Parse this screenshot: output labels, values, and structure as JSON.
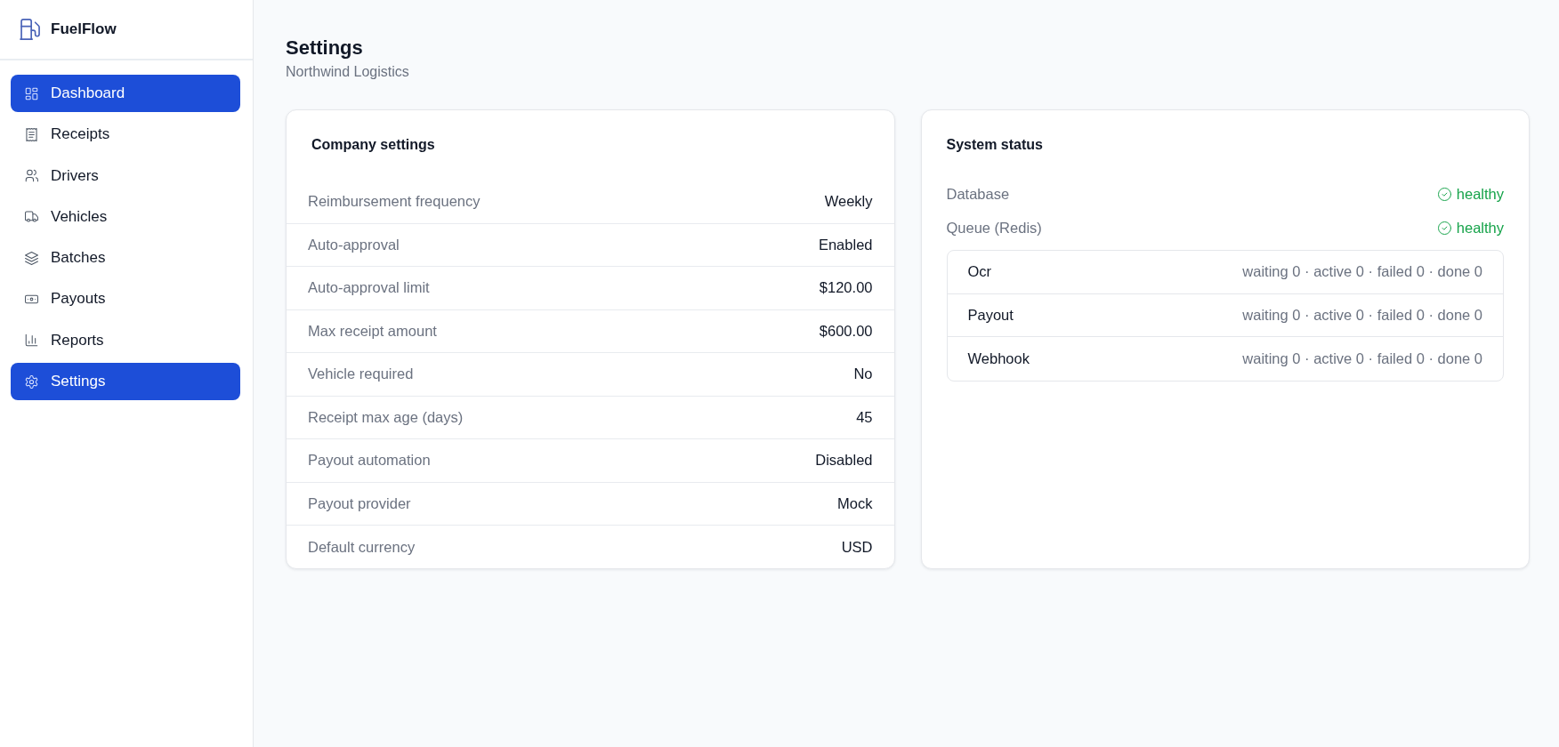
{
  "sidebar": {
    "brand": "FuelFlow",
    "items": [
      {
        "label": "Dashboard",
        "selected": true
      },
      {
        "label": "Receipts",
        "selected": false
      },
      {
        "label": "Drivers",
        "selected": false
      },
      {
        "label": "Vehicles",
        "selected": false
      },
      {
        "label": "Batches",
        "selected": false
      },
      {
        "label": "Payouts",
        "selected": false
      },
      {
        "label": "Reports",
        "selected": false
      },
      {
        "label": "Settings",
        "selected": true
      }
    ]
  },
  "header": {
    "title": "Settings",
    "subtitle": "Northwind Logistics"
  },
  "company_settings": {
    "title": "Company settings",
    "rows": [
      {
        "label": "Reimbursement frequency",
        "value": "Weekly"
      },
      {
        "label": "Auto-approval",
        "value": "Enabled"
      },
      {
        "label": "Auto-approval limit",
        "value": "$120.00"
      },
      {
        "label": "Max receipt amount",
        "value": "$600.00"
      },
      {
        "label": "Vehicle required",
        "value": "No"
      },
      {
        "label": "Receipt max age (days)",
        "value": "45"
      },
      {
        "label": "Payout automation",
        "value": "Disabled"
      },
      {
        "label": "Payout provider",
        "value": "Mock"
      },
      {
        "label": "Default currency",
        "value": "USD"
      }
    ]
  },
  "system_status": {
    "title": "System status",
    "services": [
      {
        "name": "Database",
        "status": "healthy",
        "healthy": true
      },
      {
        "name": "Queue (Redis)",
        "status": "healthy",
        "healthy": true
      }
    ],
    "queues": [
      {
        "name": "Ocr",
        "stats": "waiting 0 · active 0 · failed 0 · done 0"
      },
      {
        "name": "Payout",
        "stats": "waiting 0 · active 0 · failed 0 · done 0"
      },
      {
        "name": "Webhook",
        "stats": "waiting 0 · active 0 · failed 0 · done 0"
      }
    ]
  }
}
